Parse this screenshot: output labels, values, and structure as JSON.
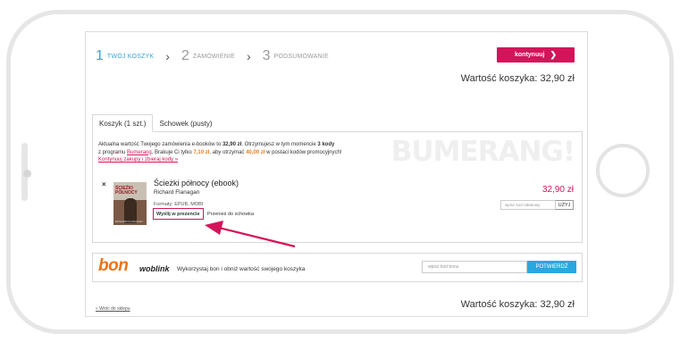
{
  "colors": {
    "accent": "#d4145a",
    "active_step": "#3aa4d8",
    "bon_orange": "#e8751a",
    "confirm_blue": "#29a8e0"
  },
  "steps": [
    {
      "number": "1",
      "label": "TWÓJ KOSZYK",
      "active": true
    },
    {
      "number": "2",
      "label": "ZAMÓWIENIE",
      "active": false
    },
    {
      "number": "3",
      "label": "PODSUMOWANIE",
      "active": false
    }
  ],
  "continue_button": {
    "label": "kontynuuj",
    "icon": "chevron-right-icon"
  },
  "cart_total_label": "Wartość koszyka: 32,90 zł",
  "tabs": [
    {
      "label": "Koszyk (1 szt.)",
      "active": true
    },
    {
      "label": "Schowek (pusty)",
      "active": false
    }
  ],
  "bumerang": {
    "watermark": "BUMERANG!",
    "line1_a": "Aktualna wartość Twojego zamówienia e-booków to ",
    "line1_b": "32,90 zł",
    "line1_c": ". Otrzymujesz w tym momencie ",
    "line1_d": "3 kody",
    "line2_a": "z programu ",
    "line2_b": "Bumerang",
    "line2_c": ". Brakuje Ci tylko ",
    "line2_d": "7,10 zł",
    "line2_e": ", aby otrzymać ",
    "line2_f": "40,00 zł",
    "line2_g": " w postaci kodów promocyjnych!",
    "link": "Kontynuuj zakupy i zbieraj kody »"
  },
  "item": {
    "remove": "×",
    "title": "Ścieżki północy (ebook)",
    "author": "Richard Flanagan",
    "formats": "Formaty: EPUB, MOBI",
    "cover_title": "ŚCIEŻKI PÓŁNOCY",
    "cover_author": "RICHARD FLANAGAN",
    "send_gift": "Wyślij w prezencie",
    "move_to_storage": "Przenieś do schowka",
    "price": "32,90 zł",
    "coupon_placeholder": "wpisz kod rabatowy",
    "coupon_button": "UŻYJ"
  },
  "bon": {
    "logo_bon": "bon",
    "logo_woblink": "woblink",
    "text": "Wykorzystaj bon i obniż wartość swojego koszyka",
    "input_placeholder": "wpisz kod bonu",
    "confirm_button": "POTWIERDŹ"
  },
  "back_link": "« Wróć do sklepu"
}
